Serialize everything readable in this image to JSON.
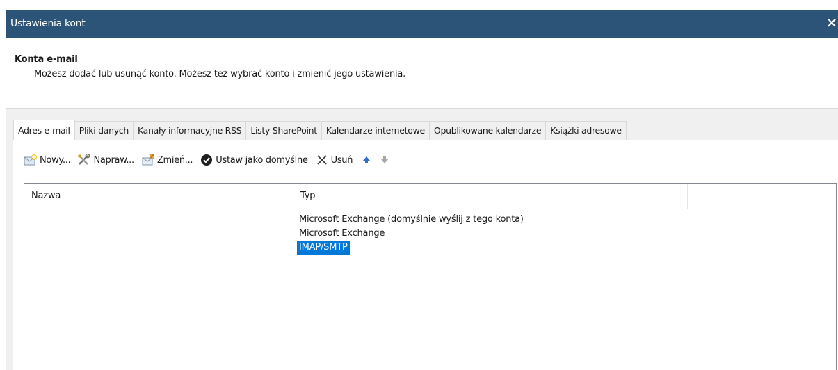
{
  "window": {
    "title": "Ustawienia kont",
    "close_glyph": "✕"
  },
  "header": {
    "title": "Konta e-mail",
    "description": "Możesz dodać lub usunąć konto. Możesz też wybrać konto i zmienić jego ustawienia."
  },
  "tabs": [
    {
      "label": "Adres e-mail",
      "active": true
    },
    {
      "label": "Pliki danych"
    },
    {
      "label": "Kanały informacyjne RSS"
    },
    {
      "label": "Listy SharePoint"
    },
    {
      "label": "Kalendarze internetowe"
    },
    {
      "label": "Opublikowane kalendarze"
    },
    {
      "label": "Książki adresowe"
    }
  ],
  "toolbar": {
    "new_label": "Nowy...",
    "repair_label": "Napraw...",
    "change_label": "Zmień...",
    "set_default_label": "Ustaw jako domyślne",
    "remove_label": "Usuń",
    "icons": {
      "new": "new-mail-icon",
      "repair": "tools-icon",
      "change": "change-icon",
      "set_default": "checkmark-icon",
      "remove": "x-icon",
      "up": "arrow-up-icon",
      "down": "arrow-down-icon"
    }
  },
  "list": {
    "columns": [
      "Nazwa",
      "Typ"
    ],
    "rows": [
      {
        "name": "",
        "type": "Microsoft Exchange (domyślnie wyślij z tego konta)"
      },
      {
        "name": "",
        "type": "Microsoft Exchange"
      },
      {
        "name": "",
        "type": "IMAP/SMTP",
        "selected": true
      }
    ]
  },
  "colors": {
    "titlebar": "#2b5478",
    "selection": "#0078d7",
    "accent_arrow": "#2e6fd1"
  }
}
